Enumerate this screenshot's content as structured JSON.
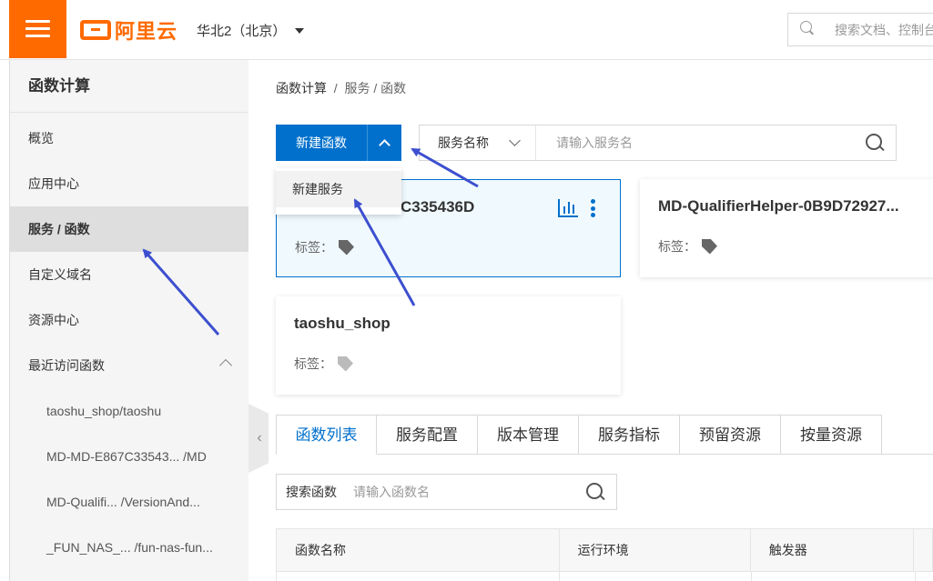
{
  "header": {
    "logo_text": "阿里云",
    "region": "华北2（北京）",
    "search_placeholder": "搜索文档、控制台"
  },
  "sidebar": {
    "title": "函数计算",
    "items": [
      {
        "label": "概览"
      },
      {
        "label": "应用中心"
      },
      {
        "label": "服务 / 函数",
        "active": true
      },
      {
        "label": "自定义域名"
      },
      {
        "label": "资源中心"
      },
      {
        "label": "最近访问函数"
      }
    ],
    "recent": [
      {
        "label": "taoshu_shop/taoshu"
      },
      {
        "label": "MD-MD-E867C33543... /MD"
      },
      {
        "label": "MD-Qualifi...  /VersionAnd..."
      },
      {
        "label": "_FUN_NAS_... /fun-nas-fun..."
      }
    ]
  },
  "breadcrumb": {
    "root": "函数计算",
    "sep": "/",
    "current": "服务 / 函数"
  },
  "toolbar": {
    "new_function_label": "新建函数",
    "dropdown_item": "新建服务",
    "service_select_label": "服务名称",
    "service_search_placeholder": "请输入服务名"
  },
  "services": [
    {
      "name": "C335436D",
      "tag_label": "标签："
    },
    {
      "name": "MD-QualifierHelper-0B9D72927...",
      "tag_label": "标签："
    },
    {
      "name": "taoshu_shop",
      "tag_label": "标签："
    }
  ],
  "tabs": [
    {
      "label": "函数列表",
      "active": true
    },
    {
      "label": "服务配置"
    },
    {
      "label": "版本管理"
    },
    {
      "label": "服务指标"
    },
    {
      "label": "预留资源"
    },
    {
      "label": "按量资源"
    }
  ],
  "function_search": {
    "label": "搜索函数",
    "placeholder": "请输入函数名"
  },
  "table": {
    "columns": [
      "函数名称",
      "运行环境",
      "触发器",
      ""
    ]
  },
  "colors": {
    "brand": "#ff6a00",
    "primary": "#0070cc",
    "annotation_arrow": "#3d4fcf"
  },
  "icons": [
    "menu-icon",
    "search-icon",
    "chevron-down-icon",
    "chevron-up-icon",
    "tag-icon",
    "bar-chart-icon",
    "more-icon",
    "chevron-left-icon"
  ]
}
